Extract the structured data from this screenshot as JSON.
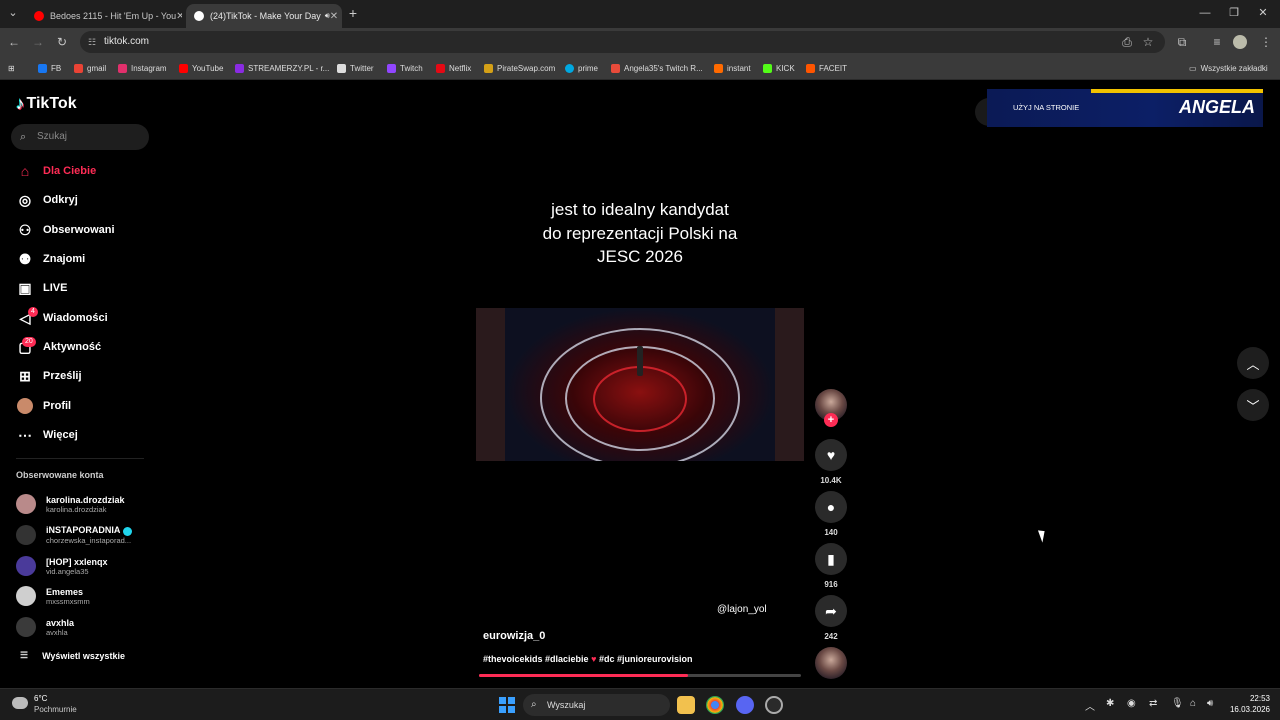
{
  "browser": {
    "tabs": [
      {
        "title": "Bedoes 2115 - Hit 'Em Up - You",
        "icon_color": "#ff0000"
      },
      {
        "title": "(24)TikTok - Make Your Day",
        "icon_color": "#ffffff"
      }
    ],
    "new_tab": "+",
    "url": "tiktok.com",
    "bookmarks": [
      {
        "label": "FB",
        "color": "#1877f2"
      },
      {
        "label": "gmail",
        "color": "#ea4335"
      },
      {
        "label": "Instagram",
        "color": "#e1306c"
      },
      {
        "label": "YouTube",
        "color": "#ff0000"
      },
      {
        "label": "STREAMERZY.PL - r...",
        "color": "#8a2be2"
      },
      {
        "label": "Twitter",
        "color": "#dddddd"
      },
      {
        "label": "Twitch",
        "color": "#9146ff"
      },
      {
        "label": "Netflix",
        "color": "#e50914"
      },
      {
        "label": "PirateSwap.com",
        "color": "#d4a017"
      },
      {
        "label": "prime",
        "color": "#00a8e1"
      },
      {
        "label": "Angela35's Twitch R...",
        "color": "#e84b3a"
      },
      {
        "label": "instant",
        "color": "#ff6a00"
      },
      {
        "label": "KICK",
        "color": "#53fc18"
      },
      {
        "label": "FACEIT",
        "color": "#ff5500"
      }
    ],
    "all_bookmarks": "Wszystkie zakładki"
  },
  "sidebar": {
    "logo": "TikTok",
    "search_placeholder": "Szukaj",
    "nav": [
      {
        "label": "Dla Ciebie",
        "icon": "home-icon",
        "active": true
      },
      {
        "label": "Odkryj",
        "icon": "compass-icon"
      },
      {
        "label": "Obserwowani",
        "icon": "following-icon"
      },
      {
        "label": "Znajomi",
        "icon": "friends-icon"
      },
      {
        "label": "LIVE",
        "icon": "live-icon"
      },
      {
        "label": "Wiadomości",
        "icon": "message-icon",
        "badge": "4"
      },
      {
        "label": "Aktywność",
        "icon": "activity-icon",
        "badge": "20"
      },
      {
        "label": "Prześlij",
        "icon": "upload-icon"
      },
      {
        "label": "Profil",
        "icon": "profile-avatar"
      },
      {
        "label": "Więcej",
        "icon": "more-icon"
      }
    ],
    "followed_title": "Obserwowane konta",
    "accounts": [
      {
        "name": "karolina.drozdziak",
        "handle": "karolina.drozdziak",
        "color": "#b98a8a"
      },
      {
        "name": "iNSTAPORADNIA",
        "handle": "chorzewska_instaporad...",
        "color": "#333333",
        "verified": true
      },
      {
        "name": "[HOP] xxlenqx",
        "handle": "vid.angela35",
        "color": "#4a3a9a"
      },
      {
        "name": "Ememes",
        "handle": "mxssmxsmm",
        "color": "#cfcfcf"
      },
      {
        "name": "avxhla",
        "handle": "avxhla",
        "color": "#3a3a3a"
      }
    ],
    "show_all": "Wyświetl wszystkie"
  },
  "video": {
    "caption_lines": [
      "jest to idealny kandydat",
      "do reprezentacji Polski na",
      "JESC 2026"
    ],
    "mention": "@lajon_yol",
    "author": "eurowizja_0",
    "hashtags_a": "#thevoicekids #dlaciebie",
    "hashtags_b": "#dc #junioreurovision",
    "progress": 0.65
  },
  "actions": {
    "follow": "+",
    "likes": "10.4K",
    "comments": "140",
    "saves": "916",
    "shares": "242"
  },
  "banner": {
    "use_label": "UŻYJ NA STRONIE",
    "name": "ANGELA"
  },
  "taskbar": {
    "temp": "6°C",
    "condition": "Pochmurnie",
    "search": "Wyszukaj",
    "time": "22:53",
    "date": "16.03.2026"
  }
}
